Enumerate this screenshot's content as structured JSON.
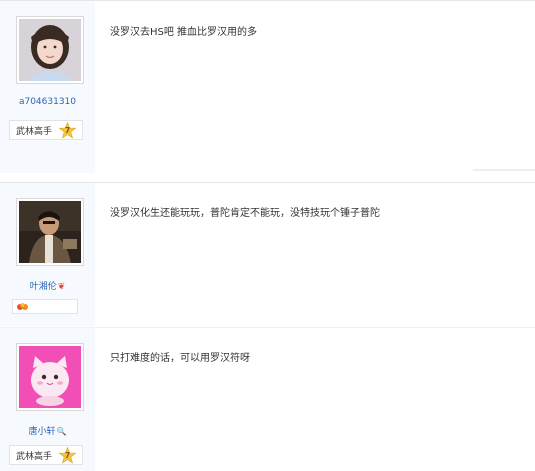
{
  "posts": [
    {
      "username": "a704631310",
      "user_mark": "",
      "rank_label": "武林高手",
      "level": "7",
      "avatar": "girl-avatar",
      "text": "没罗汉去HS吧 推血比罗汉用的多"
    },
    {
      "username": "叶湘伦",
      "user_mark": "❦",
      "rank_label": "",
      "level": "",
      "avatar": "man-avatar",
      "text": "没罗汉化生还能玩玩，普陀肯定不能玩，没特技玩个锤子普陀"
    },
    {
      "username": "唐小轩",
      "user_mark": "🔍",
      "rank_label": "武林高手",
      "level": "7",
      "avatar": "pink-cat-avatar",
      "text": "只打难度的话，可以用罗汉符呀"
    }
  ],
  "colors": {
    "username": "#2d64b3",
    "sidebar_bg": "#f6f9fd",
    "text": "#333333"
  }
}
